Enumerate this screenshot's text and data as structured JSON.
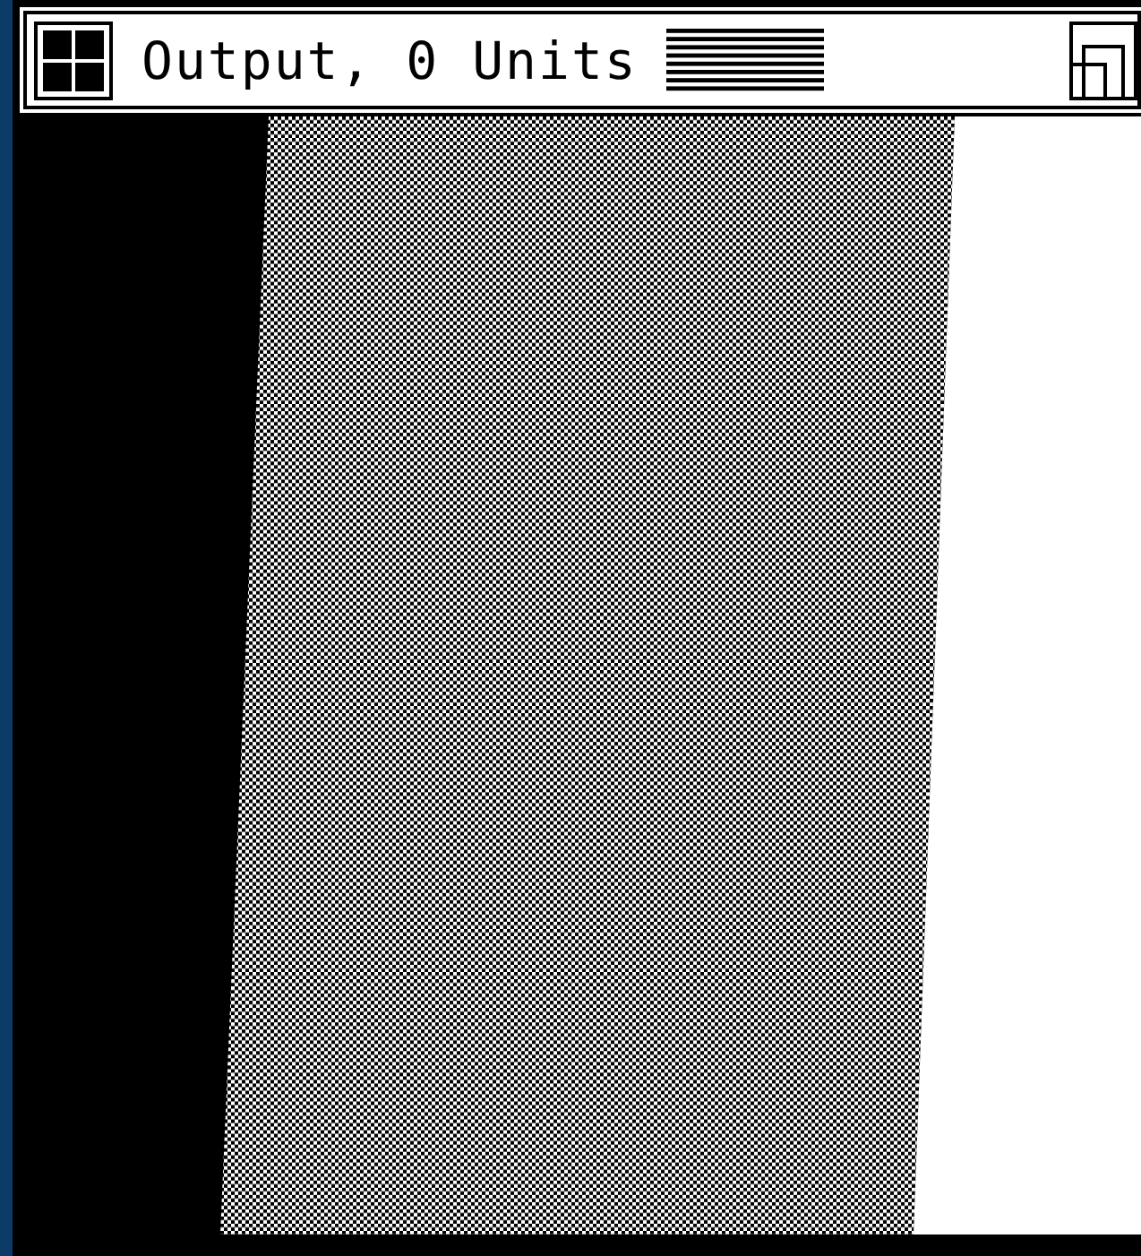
{
  "window": {
    "title": "Output, 0 Units"
  }
}
